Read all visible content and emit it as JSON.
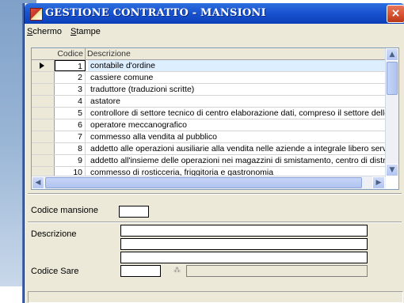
{
  "window": {
    "title": "GESTIONE CONTRATTO - MANSIONI",
    "close_label": "×"
  },
  "menu": {
    "items": [
      {
        "first": "S",
        "rest": "chermo"
      },
      {
        "first": "S",
        "rest": "tampe"
      }
    ]
  },
  "grid": {
    "columns": {
      "code": "Codice",
      "desc": "Descrizione"
    },
    "rows": [
      {
        "code": "1",
        "desc": "contabile d'ordine"
      },
      {
        "code": "2",
        "desc": "cassiere  comune"
      },
      {
        "code": "3",
        "desc": "traduttore (traduzioni scritte)"
      },
      {
        "code": "4",
        "desc": "astatore"
      },
      {
        "code": "5",
        "desc": "controllore di settore tecnico di centro elaborazione dati, compreso il settore delle"
      },
      {
        "code": "6",
        "desc": "operatore meccanografico"
      },
      {
        "code": "7",
        "desc": "commesso alla vendita al pubblico"
      },
      {
        "code": "8",
        "desc": "addetto alle operazioni ausiliarie alla vendita nelle aziende a integrale libero servizi"
      },
      {
        "code": "9",
        "desc": "addetto all'insieme delle operazioni nei magazzini di smistamento, centro di distribu"
      },
      {
        "code": "10",
        "desc": "commesso di rosticceria, friggitoria e gastronomia"
      }
    ],
    "scroll": {
      "up": "▲",
      "down": "▼",
      "left": "◀",
      "right": "▶"
    }
  },
  "form": {
    "codice_mansione_label": "Codice mansione",
    "codice_mansione_value": "",
    "descrizione_label": "Descrizione",
    "descrizione_lines": [
      "",
      "",
      ""
    ],
    "codice_sare_label": "Codice Sare",
    "codice_sare_value": "",
    "codice_sare_desc": "",
    "sare_lookup_glyph": "⁂"
  }
}
